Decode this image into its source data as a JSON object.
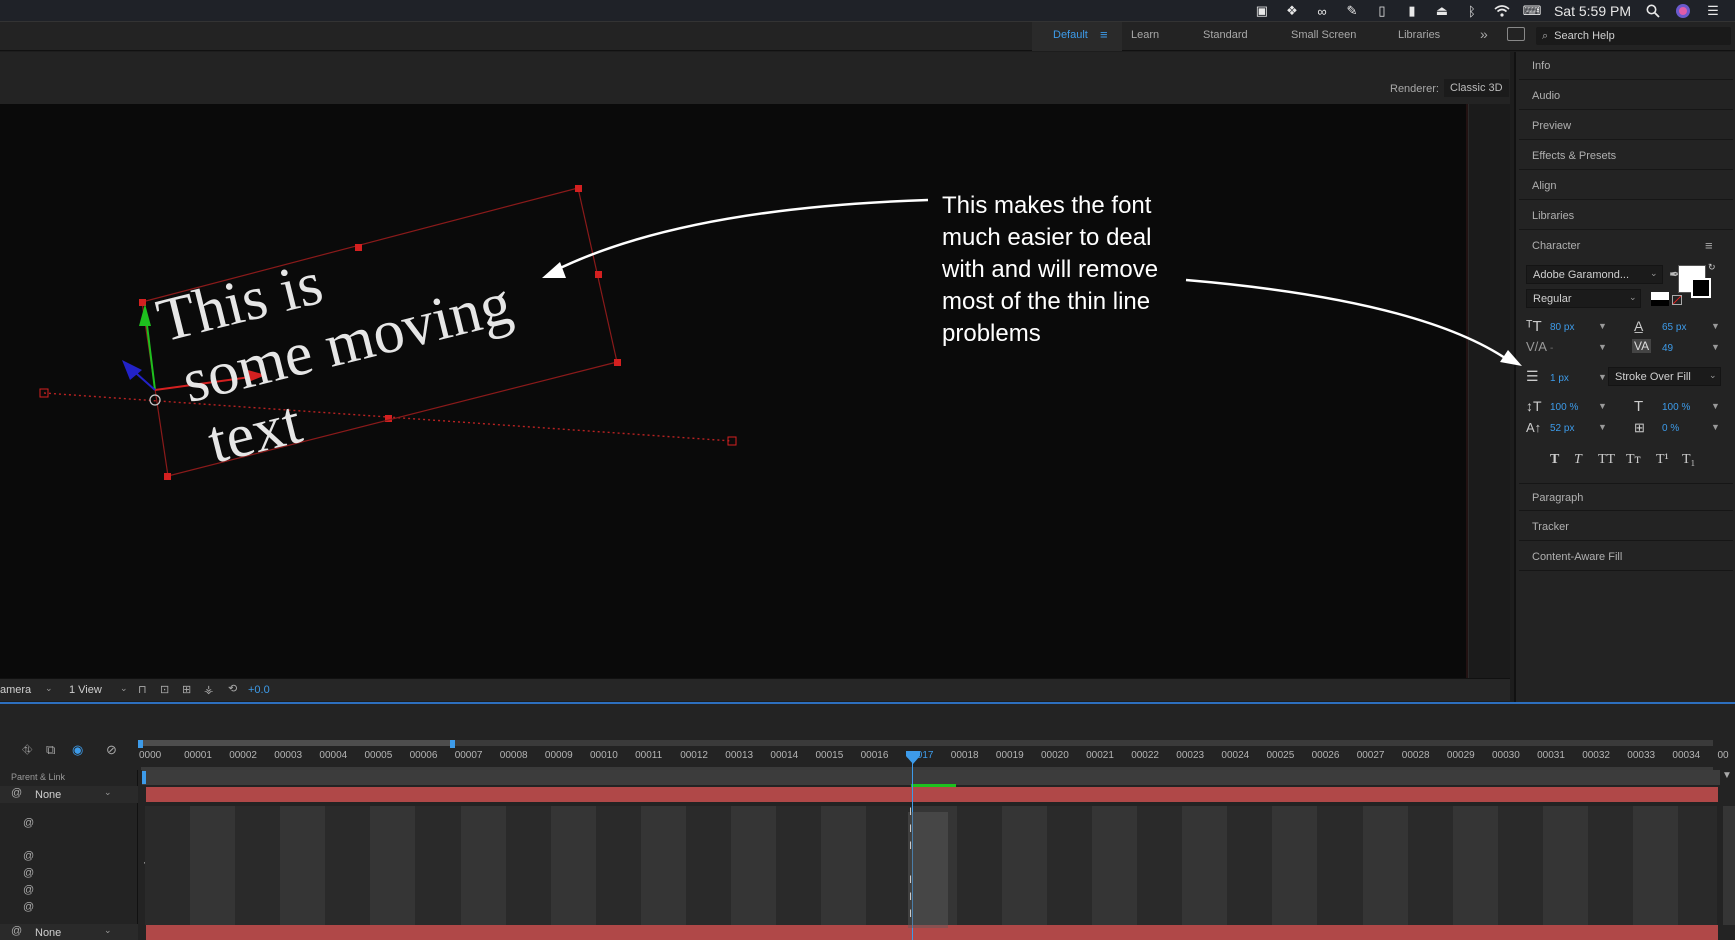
{
  "menubar": {
    "clock": "Sat 5:59 PM",
    "icons": [
      "display-icon",
      "dropbox-icon",
      "creative-cloud-icon",
      "edit-icon",
      "phone-icon",
      "battery-icon",
      "airplay-icon",
      "bluetooth-icon",
      "wifi-icon",
      "keyboard-icon",
      "spotlight-icon",
      "siri-icon",
      "notification-center-icon"
    ]
  },
  "workspace": {
    "tabs": [
      "Default",
      "Learn",
      "Standard",
      "Small Screen",
      "Libraries"
    ],
    "active_tab": "Default",
    "more": "»",
    "search_placeholder": "Search Help"
  },
  "composition": {
    "renderer_label": "Renderer:",
    "renderer_value": "Classic 3D",
    "layer_text_lines": [
      "This is",
      "some moving",
      "text"
    ]
  },
  "viewer_bar": {
    "camera": "amera",
    "view": "1 View",
    "exposure": "+0.0"
  },
  "annotation": {
    "lines": [
      "This makes the font",
      "much easier to deal",
      "with and will remove",
      "most of the thin line",
      "problems"
    ]
  },
  "right_panel": {
    "sections_top": [
      "Info",
      "Audio",
      "Preview",
      "Effects & Presets",
      "Align",
      "Libraries"
    ],
    "character_title": "Character",
    "font_family": "Adobe Garamond...",
    "font_style": "Regular",
    "font_size": "80 px",
    "leading": "65 px",
    "kerning": "-",
    "tracking": "49",
    "stroke_width": "1 px",
    "stroke_mode": "Stroke Over Fill",
    "vert_scale": "100 %",
    "horiz_scale": "100 %",
    "baseline_shift": "52 px",
    "tsume": "0 %",
    "style_buttons": [
      "T",
      "T",
      "TT",
      "Tт",
      "T¹",
      "T₁"
    ],
    "sections_bottom": [
      "Paragraph",
      "Tracker",
      "Content-Aware Fill"
    ]
  },
  "timeline": {
    "ruler_labels": [
      "0000",
      "00001",
      "00002",
      "00003",
      "00004",
      "00005",
      "00006",
      "00007",
      "00008",
      "00009",
      "00010",
      "00011",
      "00012",
      "00013",
      "00014",
      "00015",
      "00016",
      "00017",
      "00018",
      "00019",
      "00020",
      "00021",
      "00022",
      "00023",
      "00024",
      "00025",
      "00026",
      "00027",
      "00028",
      "00029",
      "00030",
      "00031",
      "00032",
      "00033",
      "00034",
      "00"
    ],
    "column_header": "Parent & Link",
    "parent_top": "None",
    "parent_bottom": "None",
    "current_frame_index": 17
  },
  "colors": {
    "accent": "#3d9be9",
    "layer_bar": "#b04848",
    "handle": "#d42020"
  }
}
